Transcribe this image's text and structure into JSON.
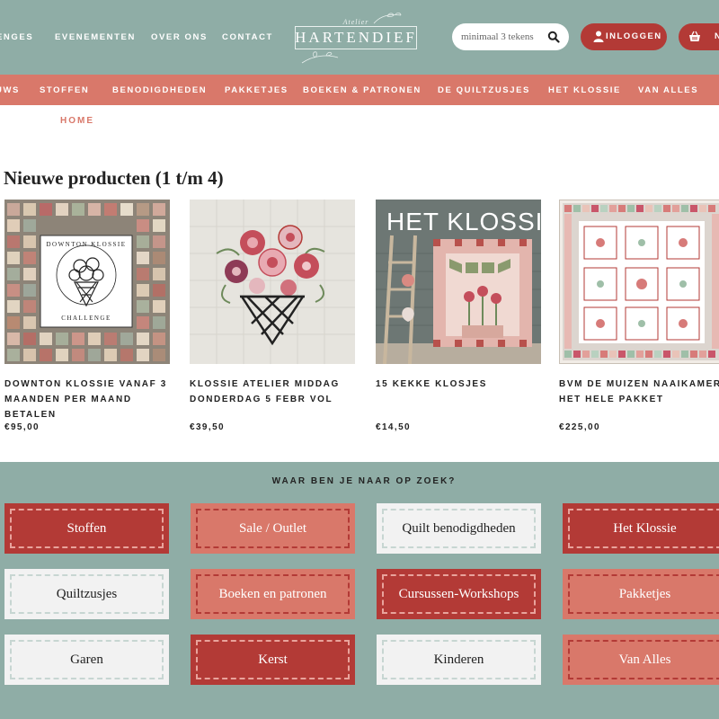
{
  "colors": {
    "teal": "#8fada6",
    "salmon": "#d9786a",
    "red": "#b33a36",
    "light": "#f2f2f2"
  },
  "top_nav": [
    "ENGES",
    "EVENEMENTEN",
    "OVER ONS",
    "CONTACT"
  ],
  "logo": {
    "small": "Atelier",
    "main": "HARTENDIEF"
  },
  "search": {
    "placeholder": "minimaal 3 tekens",
    "icon": "search-icon"
  },
  "login": {
    "label": "INLOGGEN",
    "icon": "user-icon"
  },
  "cart": {
    "label": "N",
    "icon": "basket-icon"
  },
  "category_nav": [
    "UWS",
    "STOFFEN",
    "BENODIGDHEDEN",
    "PAKKETJES",
    "BOEKEN & PATRONEN",
    "DE QUILTZUSJES",
    "HET KLOSSIE",
    "VAN ALLES"
  ],
  "breadcrumb": "HOME",
  "section_title": "Nieuwe producten (1 t/m 4)",
  "products": [
    {
      "name": "DOWNTON KLOSSIE VANAF 3 MAANDEN PER MAAND BETALEN",
      "price": "€95,00",
      "image_text": [
        "DOWNTON KLOSSIE",
        "CHALLENGE"
      ]
    },
    {
      "name": "KLOSSIE ATELIER MIDDAG DONDERDAG 5 FEBR VOL",
      "price": "€39,50"
    },
    {
      "name": "15 KEKKE KLOSJES",
      "price": "€14,50",
      "image_text": [
        "HET KLOSSIE"
      ]
    },
    {
      "name": "BVM DE MUIZEN NAAIKAMER HET HELE PAKKET",
      "price": "€225,00"
    }
  ],
  "finder": {
    "title": "WAAR BEN JE NAAR OP ZOEK?",
    "tiles": [
      {
        "label": "Stoffen",
        "style": "red"
      },
      {
        "label": "Sale / Outlet",
        "style": "salmon"
      },
      {
        "label": "Quilt benodigdheden",
        "style": "light"
      },
      {
        "label": "Het Klossie",
        "style": "red"
      },
      {
        "label": "Quiltzusjes",
        "style": "light"
      },
      {
        "label": "Boeken en patronen",
        "style": "salmon"
      },
      {
        "label": "Cursussen-Workshops",
        "style": "red"
      },
      {
        "label": "Pakketjes",
        "style": "salmon"
      },
      {
        "label": "Garen",
        "style": "light"
      },
      {
        "label": "Kerst",
        "style": "red"
      },
      {
        "label": "Kinderen",
        "style": "light"
      },
      {
        "label": "Van Alles",
        "style": "salmon"
      }
    ]
  }
}
